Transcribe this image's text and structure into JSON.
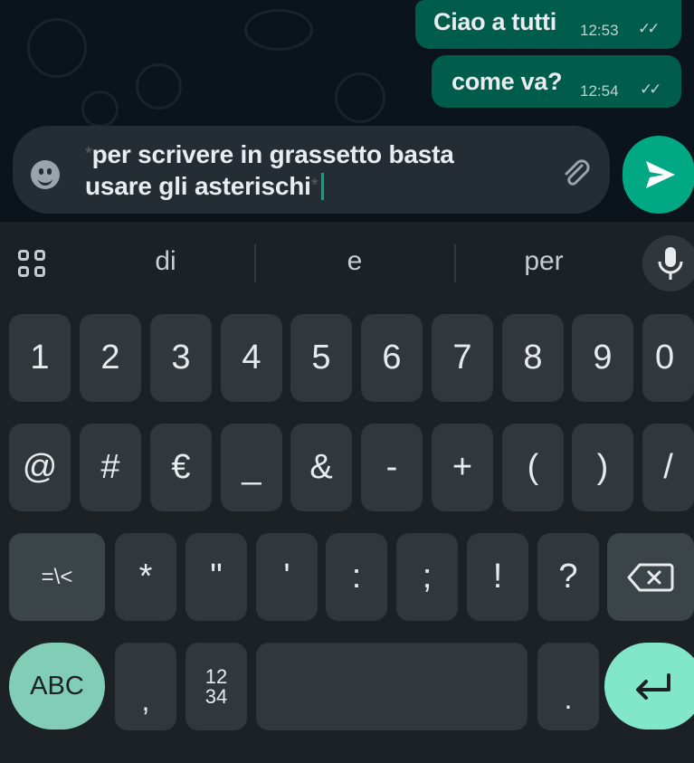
{
  "chat": {
    "messages": [
      {
        "text": "Ciao a tutti",
        "time": "12:53",
        "status": "read"
      },
      {
        "text": "come va?",
        "time": "12:54",
        "status": "read"
      }
    ]
  },
  "composer": {
    "prefix_marker": "*",
    "line1": "per scrivere in grassetto basta",
    "line2": "usare gli asterischi",
    "suffix_marker": "*",
    "icons": {
      "emoji": "emoji-icon",
      "attach": "paperclip-icon",
      "send": "send-icon"
    }
  },
  "keyboard": {
    "suggestions": [
      "di",
      "e",
      "per"
    ],
    "icons": {
      "apps": "apps-grid-icon",
      "mic": "microphone-icon",
      "backspace": "backspace-icon",
      "enter": "enter-icon"
    },
    "row1": [
      "1",
      "2",
      "3",
      "4",
      "5",
      "6",
      "7",
      "8",
      "9",
      "0"
    ],
    "row2": [
      "@",
      "#",
      "€",
      "_",
      "&",
      "-",
      "+",
      "(",
      ")",
      "/"
    ],
    "row3_left": "=\\<",
    "row3": [
      "*",
      "\"",
      "'",
      ":",
      ";",
      "!",
      "?"
    ],
    "row4": {
      "abc": "ABC",
      "comma": ",",
      "numpad_top": "12",
      "numpad_bottom": "34",
      "period": "."
    },
    "colors": {
      "accent": "#00a884",
      "bubble": "#005c4b",
      "abc_key": "#82cdb5",
      "enter_key": "#82e6c8"
    }
  }
}
